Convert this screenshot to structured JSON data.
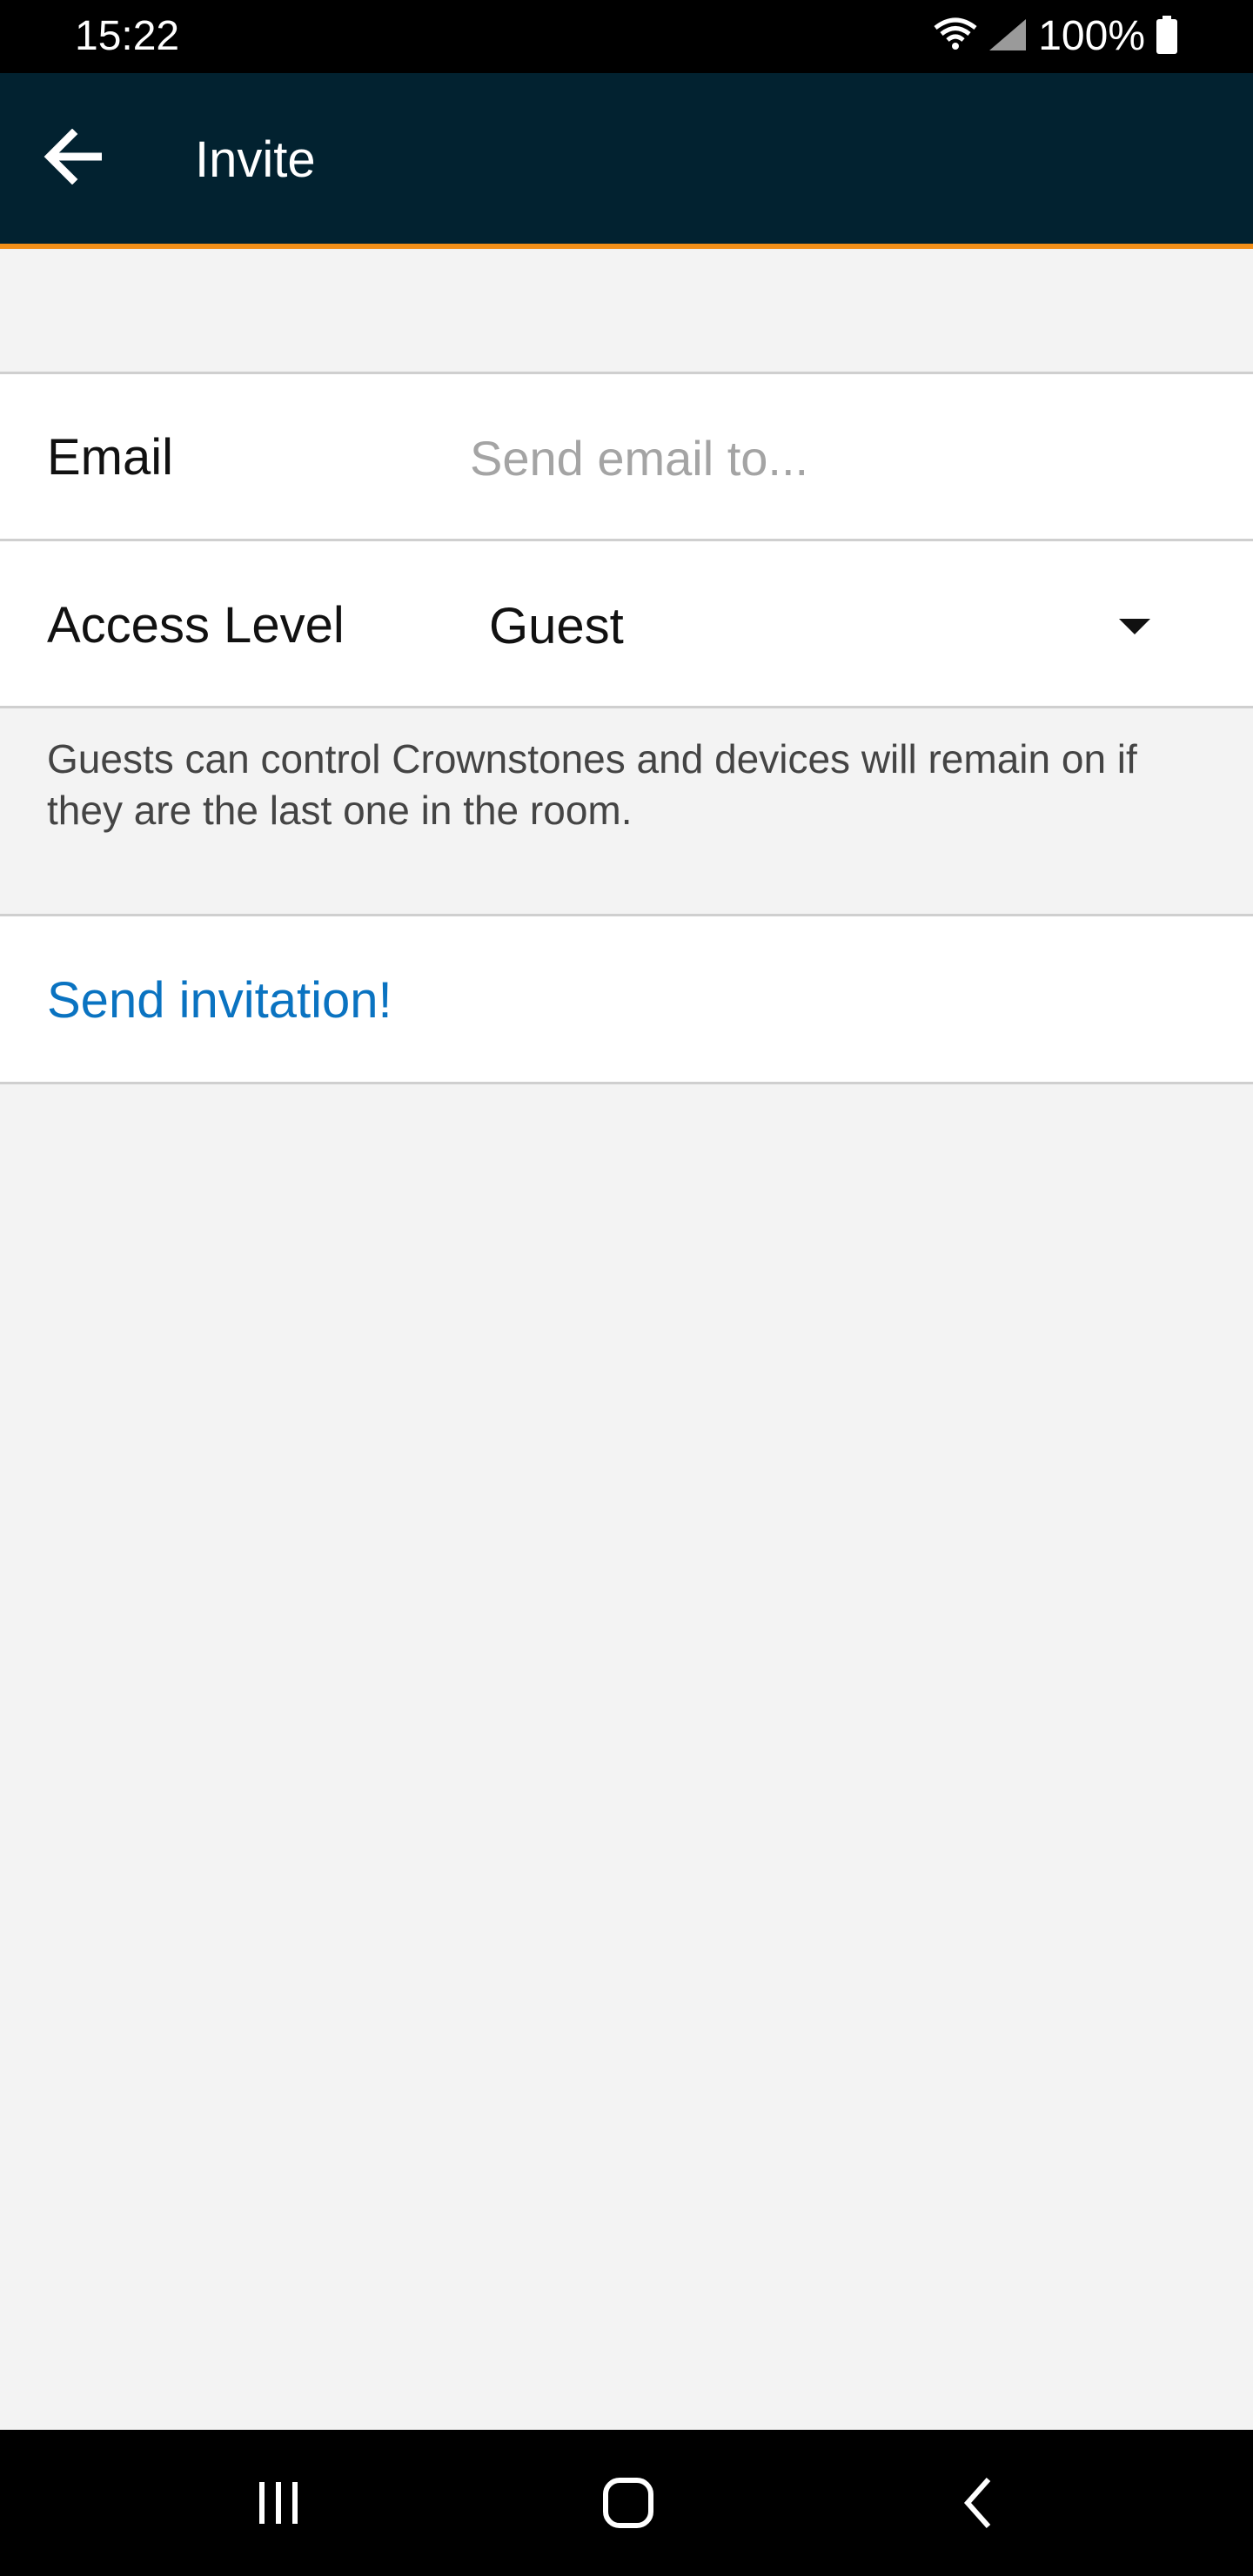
{
  "status_bar": {
    "time": "15:22",
    "battery": "100%",
    "icons": [
      "wifi-icon",
      "cell-signal-icon",
      "battery-icon"
    ]
  },
  "app_bar": {
    "title": "Invite",
    "back_icon": "back-arrow-icon"
  },
  "form": {
    "email_label": "Email",
    "email_value": "",
    "email_placeholder": "Send email to...",
    "access_label": "Access Level",
    "access_value": "Guest",
    "access_icon": "dropdown-triangle-icon",
    "helper_text": "Guests can control Crownstones and devices will remain on if they are the last one in the room.",
    "send_label": "Send invitation!"
  },
  "nav_bar": {
    "icons": [
      "recent-apps-icon",
      "home-icon",
      "back-icon"
    ]
  },
  "colors": {
    "app_bar_bg": "#022230",
    "accent": "#f39019",
    "link": "#0a73c1",
    "page_bg": "#f3f3f3"
  }
}
